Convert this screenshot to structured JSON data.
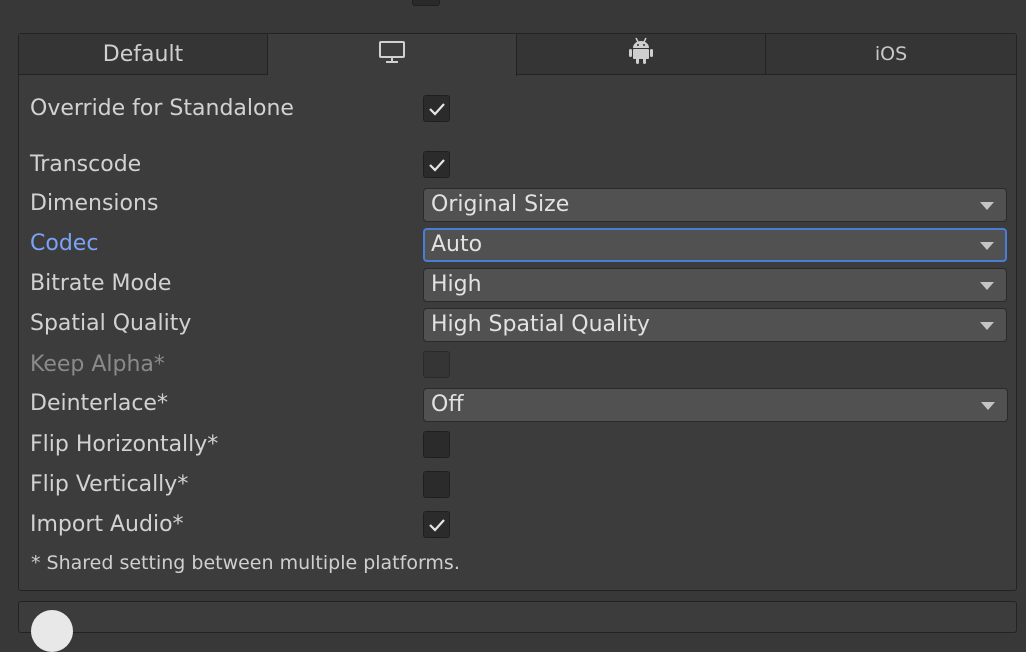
{
  "tabs": [
    {
      "label": "Default",
      "icon": null,
      "active": false
    },
    {
      "label": "",
      "icon": "monitor-icon",
      "active": true
    },
    {
      "label": "",
      "icon": "android-icon",
      "active": false
    },
    {
      "label": "iOS",
      "icon": null,
      "active": false
    }
  ],
  "settings": {
    "override": {
      "label": "Override for Standalone",
      "checked": true
    },
    "transcode": {
      "label": "Transcode",
      "checked": true
    },
    "dimensions": {
      "label": "Dimensions",
      "value": "Original Size"
    },
    "codec": {
      "label": "Codec",
      "value": "Auto"
    },
    "bitrate_mode": {
      "label": "Bitrate Mode",
      "value": "High"
    },
    "spatial_quality": {
      "label": "Spatial Quality",
      "value": "High Spatial Quality"
    },
    "keep_alpha": {
      "label": "Keep Alpha*",
      "checked": false,
      "disabled": true
    },
    "deinterlace": {
      "label": "Deinterlace*",
      "value": "Off"
    },
    "flip_horizontally": {
      "label": "Flip Horizontally*",
      "checked": false
    },
    "flip_vertically": {
      "label": "Flip Vertically*",
      "checked": false
    },
    "import_audio": {
      "label": "Import Audio*",
      "checked": true
    }
  },
  "footnote": "* Shared setting between multiple platforms.",
  "colors": {
    "background": "#383838",
    "panel": "#3c3c3c",
    "highlight_label": "#7ba3f5",
    "focus_border": "#4a7dd6"
  }
}
